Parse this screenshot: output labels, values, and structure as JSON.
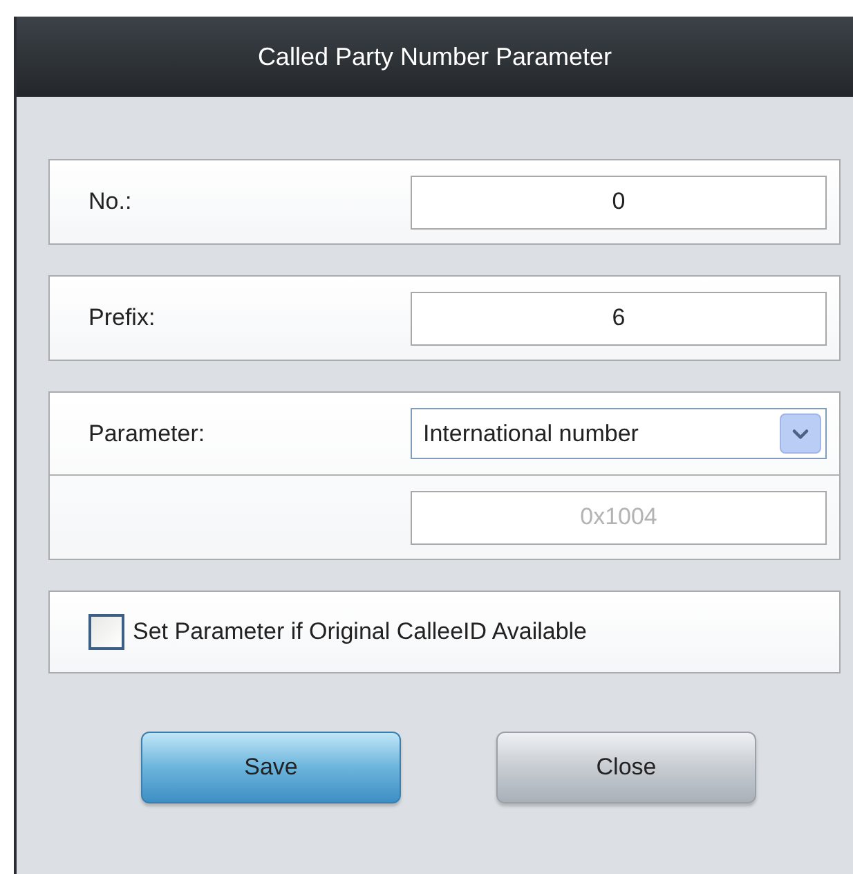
{
  "window": {
    "title": "Called Party Number Parameter"
  },
  "sections": [
    {
      "rows": [
        {
          "kind": "text",
          "label": "No.:",
          "value": "0"
        }
      ]
    },
    {
      "rows": [
        {
          "kind": "text",
          "label": "Prefix:",
          "value": "6"
        }
      ]
    },
    {
      "rows": [
        {
          "kind": "select",
          "label": "Parameter:",
          "value": "International number"
        },
        {
          "kind": "readonly",
          "value": "0x1004"
        }
      ]
    }
  ],
  "option": {
    "label": "Set Parameter if Original CalleeID Available",
    "checked": false
  },
  "buttons": [
    {
      "kind": "primary",
      "label": "Save"
    },
    {
      "kind": "secondary",
      "label": "Close"
    }
  ]
}
